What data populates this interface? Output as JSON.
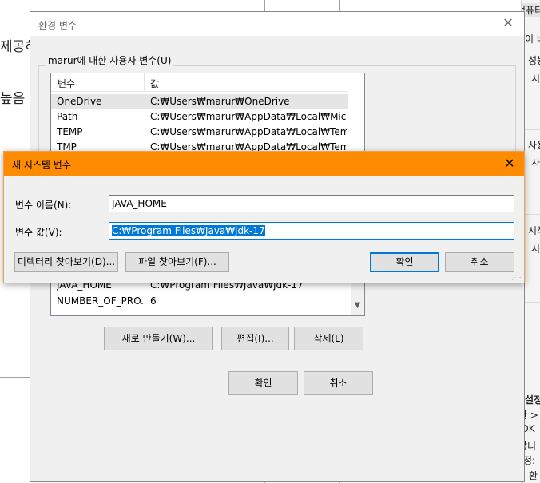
{
  "background": {
    "left_text_1": "제공하",
    "left_text_2": "높음",
    "right_items": [
      "컴퓨터",
      "이 버",
      "성능",
      "시",
      "사용",
      "사",
      "시작",
      "시",
      "설정",
      "관 >",
      "JDK",
      "않니",
      "정:",
      "린 환"
    ]
  },
  "env_dialog": {
    "title": "환경 변수",
    "close_icon": "✕",
    "user_group_label": "marur에 대한 사용자 변수(U)",
    "user_columns": [
      "변수",
      "값"
    ],
    "user_rows": [
      {
        "name": "OneDrive",
        "value": "C:₩Users₩marur₩OneDrive"
      },
      {
        "name": "Path",
        "value": "C:₩Users₩marur₩AppData₩Local₩Microso..."
      },
      {
        "name": "TEMP",
        "value": "C:₩Users₩marur₩AppData₩Local₩Temp"
      },
      {
        "name": "TMP",
        "value": "C:₩Users₩marur₩AppData₩Local₩Temp"
      }
    ],
    "system_rows": [
      {
        "name": "JAVA_HOME",
        "value": "C:₩Program Files₩Java₩jdk-17"
      },
      {
        "name": "NUMBER_OF_PRO...",
        "value": "6"
      }
    ],
    "new_button": "새로 만들기(W)...",
    "edit_button": "편집(I)...",
    "delete_button": "삭제(L)",
    "ok_button": "확인",
    "cancel_button": "취소"
  },
  "new_var_dialog": {
    "title": "새 시스템 변수",
    "close_icon": "✕",
    "name_label": "변수 이름(N):",
    "name_value": "JAVA_HOME",
    "value_label": "변수 값(V):",
    "value_value": "C:₩Program Files₩Java₩jdk-17",
    "browse_dir_button": "디렉터리 찾아보기(D)...",
    "browse_file_button": "파일 찾아보기(F)...",
    "ok_button": "확인",
    "cancel_button": "취소"
  },
  "colors": {
    "accent": "#0078d7",
    "title_orange": "#ff8c00"
  }
}
